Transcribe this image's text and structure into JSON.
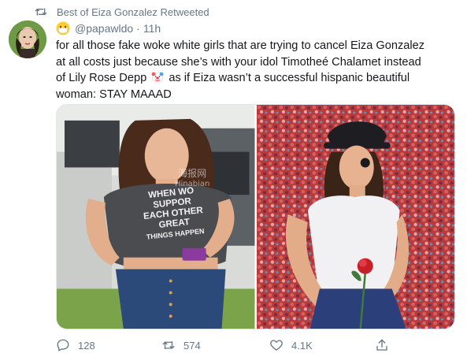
{
  "retweet": {
    "icon": "retweet-icon",
    "label": "Best of Eiza Gonzalez Retweeted"
  },
  "tweet": {
    "handle": "@papawldo",
    "separator": "·",
    "time": "11h",
    "lines": [
      "for all those fake woke white girls that are trying to cancel Eiza Gonzalez",
      "at all costs just because she’s with your idol Timotheé Chalamet instead",
      "of Lily Rose Depp",
      "as if Eiza wasn’t a successful hispanic beautiful",
      "woman: STAY MAAAD"
    ]
  },
  "media": {
    "left_shirt_text": [
      "WHEN WO",
      "SUPPOR",
      "EACH OTHER",
      "GREAT",
      "THINGS HAPPEN"
    ],
    "watermark": [
      "海报网",
      "Hinabian"
    ]
  },
  "actions": {
    "reply": {
      "icon": "reply-icon",
      "count": "128"
    },
    "retweet": {
      "icon": "retweet-icon",
      "count": "574"
    },
    "like": {
      "icon": "heart-icon",
      "count": "4.1K"
    },
    "share": {
      "icon": "share-icon"
    }
  },
  "colors": {
    "muted": "#657786",
    "text": "#14171a",
    "border": "#e1e8ed"
  }
}
